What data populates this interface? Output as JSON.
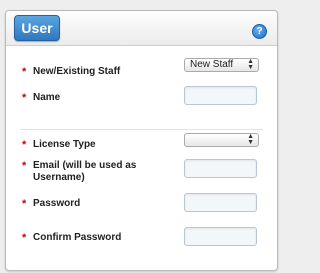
{
  "header": {
    "tab_label": "User",
    "help_symbol": "?"
  },
  "form": {
    "required_marker": "*",
    "staff_type": {
      "label": "New/Existing Staff",
      "selected": "New Staff"
    },
    "name": {
      "label": "Name",
      "value": ""
    },
    "license_type": {
      "label": "License Type",
      "selected": ""
    },
    "email": {
      "label": "Email (will be used as Username)",
      "value": ""
    },
    "password": {
      "label": "Password",
      "value": ""
    },
    "confirm_password": {
      "label": "Confirm Password",
      "value": ""
    }
  },
  "icons": {
    "help": "help-icon",
    "select_arrows": "up-down-arrows-icon"
  }
}
